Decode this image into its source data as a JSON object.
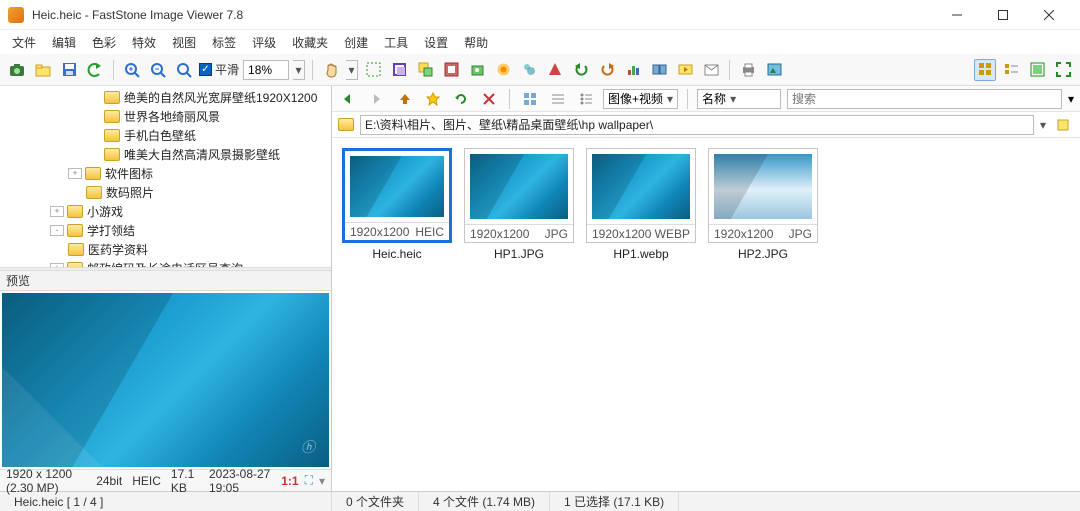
{
  "title": "Heic.heic  -  FastStone Image Viewer 7.8",
  "menus": [
    "文件",
    "编辑",
    "色彩",
    "特效",
    "视图",
    "标签",
    "评级",
    "收藏夹",
    "创建",
    "工具",
    "设置",
    "帮助"
  ],
  "toolbar": {
    "smooth_label": "平滑",
    "zoom_pct": "18%",
    "icons": {
      "acquire": "camera-icon",
      "new": "new-folder-icon",
      "save": "save-icon",
      "undo": "undo-icon",
      "prev": "prev-icon",
      "next": "next-icon",
      "zoomin": "zoom-in-icon",
      "zoomout": "zoom-out-icon",
      "fit": "fit-icon",
      "hand": "hand-icon",
      "select": "select-icon",
      "crop": "crop-icon",
      "resize": "resize-icon",
      "canvas": "canvas-icon",
      "rotate": "rotate-icon",
      "adjust": "adjust-icon",
      "blur": "blur-icon",
      "sharpen": "sharpen-icon",
      "redeye": "redeye-icon",
      "clone": "clone-icon",
      "rotleft": "rotate-left-icon",
      "rotright": "rotate-right-icon",
      "histogram": "histogram-icon",
      "compare": "compare-icon",
      "slideshow": "slideshow-icon",
      "email": "email-icon",
      "print": "print-icon",
      "wallpaper": "wallpaper-icon",
      "view_thumb": "view-thumb-icon",
      "view_list": "view-list-icon",
      "view_detail": "view-detail-icon",
      "fullscreen": "fullscreen-icon"
    }
  },
  "tree": [
    {
      "indent": 86,
      "tw": "",
      "label": "绝美的自然风光宽屏壁纸1920X1200"
    },
    {
      "indent": 86,
      "tw": "",
      "label": "世界各地绮丽风景"
    },
    {
      "indent": 86,
      "tw": "",
      "label": "手机白色壁纸"
    },
    {
      "indent": 86,
      "tw": "",
      "label": "唯美大自然高清风景摄影壁纸"
    },
    {
      "indent": 68,
      "tw": "+",
      "label": "软件图标"
    },
    {
      "indent": 68,
      "tw": "",
      "label": "数码照片"
    },
    {
      "indent": 50,
      "tw": "+",
      "label": "小游戏"
    },
    {
      "indent": 50,
      "tw": "-",
      "label": "学打领结"
    },
    {
      "indent": 50,
      "tw": "",
      "label": "医药学资料"
    },
    {
      "indent": 50,
      "tw": "+",
      "label": "邮政编码及长途电话区号查询"
    }
  ],
  "preview": {
    "header": "预览",
    "dims": "1920 x 1200 (2.30 MP)",
    "depth": "24bit",
    "fmt": "HEIC",
    "size": "17.1 KB",
    "date": "2023-08-27 19:05",
    "ratio": "1:1"
  },
  "filterbar": {
    "type_label": "图像+视频",
    "sort_label": "名称",
    "search_placeholder": "搜索"
  },
  "path": "E:\\资料\\相片、图片、壁纸\\精品桌面壁纸\\hp wallpaper\\",
  "thumbs": [
    {
      "name": "Heic.heic",
      "dims": "1920x1200",
      "fmt": "HEIC",
      "selected": true,
      "alt": false
    },
    {
      "name": "HP1.JPG",
      "dims": "1920x1200",
      "fmt": "JPG",
      "selected": false,
      "alt": false
    },
    {
      "name": "HP1.webp",
      "dims": "1920x1200",
      "fmt": "WEBP",
      "selected": false,
      "alt": false
    },
    {
      "name": "HP2.JPG",
      "dims": "1920x1200",
      "fmt": "JPG",
      "selected": false,
      "alt": true
    }
  ],
  "status": {
    "current": "Heic.heic [ 1 / 4 ]",
    "folders": "0 个文件夹",
    "files": "4 个文件 (1.74 MB)",
    "selected": "1 已选择 (17.1 KB)"
  }
}
